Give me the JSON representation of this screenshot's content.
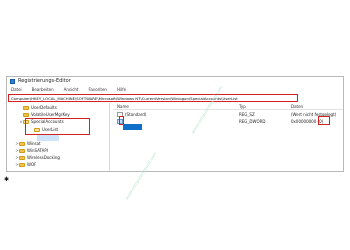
{
  "window": {
    "title": "Registrierungs-Editor",
    "menu": [
      "Datei",
      "Bearbeiten",
      "Ansicht",
      "Favoriten",
      "Hilfe"
    ],
    "address": "Computer\\HKEY_LOCAL_MACHINE\\SOFTWARE\\Microsoft\\Windows NT\\CurrentVersion\\Winlogon\\SpecialAccounts\\UserList"
  },
  "tree": {
    "items": [
      {
        "label": "UserDefaults",
        "chevron": ""
      },
      {
        "label": "VolatileUserMgrKey",
        "chevron": ""
      },
      {
        "label": "SpecialAccounts",
        "chevron": "∨"
      },
      {
        "label": "UserList",
        "chevron": ""
      },
      {
        "label": "Winsat",
        "chevron": ">"
      },
      {
        "label": "WinSATAPI",
        "chevron": ">"
      },
      {
        "label": "WirelessDocking",
        "chevron": ">"
      },
      {
        "label": "WOF",
        "chevron": ">"
      }
    ]
  },
  "list": {
    "headers": {
      "name": "Name",
      "type": "Typ",
      "data": "Daten"
    },
    "rows": [
      {
        "name": "(Standard)",
        "type": "REG_SZ",
        "data": "(Wert nicht festgelegt)"
      },
      {
        "name": "Testo",
        "type": "REG_DWORD",
        "data": "0x00000000 (0)"
      }
    ]
  },
  "watermark": "www.computerfreund.com",
  "colors": {
    "highlight": "#d32020",
    "selection": "#0f6ec7",
    "tree_selection": "#cfe3f8",
    "watermark": "#b7e7cc"
  }
}
